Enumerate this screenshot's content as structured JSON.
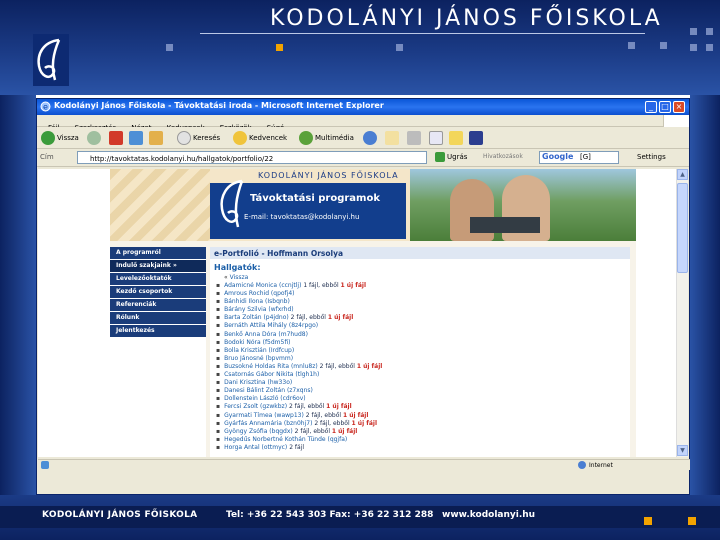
{
  "slide": {
    "title": "KODOLÁNYI JÁNOS FŐISKOLA",
    "footer": {
      "school": "KODOLÁNYI JÁNOS FŐISKOLA",
      "phone_fax": "Tel: +36 22 543 303 Fax: +36 22 312 288",
      "website": "www.kodolanyi.hu"
    }
  },
  "browser": {
    "window_title": "Kodolányi János Főiskola - Távoktatási iroda - Microsoft Internet Explorer",
    "menu": [
      "Fájl",
      "Szerkesztés",
      "Nézet",
      "Kedvencek",
      "Eszközök",
      "Súgó"
    ],
    "toolbar": {
      "back": "Vissza",
      "search": "Keresés",
      "favorites": "Kedvencek",
      "multimedia": "Multimédia"
    },
    "address_label": "Cím",
    "address_value": "http://tavoktatas.kodolanyi.hu/hallgatok/portfolio/22",
    "go_label": "Ugrás",
    "links_label": "Hivatkozások",
    "search_engine": "Google",
    "search_value": "[G]",
    "settings_label": "Settings",
    "status_zone": "Internet"
  },
  "page": {
    "school_name": "KODOLÁNYI JÁNOS FŐISKOLA",
    "program_title": "Távoktatási programok",
    "email": "E-mail: tavoktatas@kodolanyi.hu",
    "nav": [
      "A programról",
      "Indulő szakjaink »",
      "Levelezőoktatók",
      "Kezdő csoportok",
      "Referenciák",
      "Rólunk",
      "Jelentkezés"
    ],
    "portfolio_title": "e-Portfolió - Hoffmann Orsolya",
    "students_heading": "Hallgatók:",
    "back_link": "Vissza",
    "students": [
      {
        "name": "Adamicné Monica (ccnjtlj)",
        "extra": " 1 fájl, ebből ",
        "newcount": "1 új fájl"
      },
      {
        "name": "Amrous Rochid (qpofj4)",
        "extra": "",
        "newcount": ""
      },
      {
        "name": "Bánhidi Ilona (Isbqnb)",
        "extra": "",
        "newcount": ""
      },
      {
        "name": "Bárány Szilvia (wfxrhd)",
        "extra": "",
        "newcount": ""
      },
      {
        "name": "Barta Zoltán (p4jdno)",
        "extra": " 2 fájl, ebből ",
        "newcount": "1 új fájl"
      },
      {
        "name": "Bernáth Attila Mihály (8z4rpgo)",
        "extra": "",
        "newcount": ""
      },
      {
        "name": "Benkő Anna Dóra (m7hud8)",
        "extra": "",
        "newcount": ""
      },
      {
        "name": "Bodoki Nóra (f5dm5fi)",
        "extra": "",
        "newcount": ""
      },
      {
        "name": "Bolla Krisztián (Irdfcup)",
        "extra": "",
        "newcount": ""
      },
      {
        "name": "Bruo Jánosné (bpvmm)",
        "extra": "",
        "newcount": ""
      },
      {
        "name": "Buzsokné Holdas Rita (mnlu8z)",
        "extra": " 2 fájl, ebből ",
        "newcount": "1 új fájl"
      },
      {
        "name": "Csatornás Gábor Nikita (tlgh1h)",
        "extra": "",
        "newcount": ""
      },
      {
        "name": "Dani Krisztina (hw33o)",
        "extra": "",
        "newcount": ""
      },
      {
        "name": "Danesi Bálint Zoltán (z7xqns)",
        "extra": "",
        "newcount": ""
      },
      {
        "name": "Dollenstein László (cdr6ov)",
        "extra": "",
        "newcount": ""
      },
      {
        "name": "Fercsi Zsolt (gzwkbz)",
        "extra": " 2 fájl, ebből ",
        "newcount": "1 új fájl"
      },
      {
        "name": "Gyarmati Tímea (wawp13)",
        "extra": " 2 fájl, ebből ",
        "newcount": "1 új fájl"
      },
      {
        "name": "Gyárfás Annamária (bzn0hj7)",
        "extra": " 2 fájl, ebből ",
        "newcount": "1 új fájl"
      },
      {
        "name": "Gyöngy Zsófia (bqgdx)",
        "extra": " 2 fájl, ebből ",
        "newcount": "1 új fájl"
      },
      {
        "name": "Hegedűs Norbertné Kothán Tünde (qgjfa)",
        "extra": "",
        "newcount": ""
      },
      {
        "name": "Horga Antal (ottmyc)",
        "extra": " 2 fájl",
        "newcount": ""
      }
    ]
  }
}
